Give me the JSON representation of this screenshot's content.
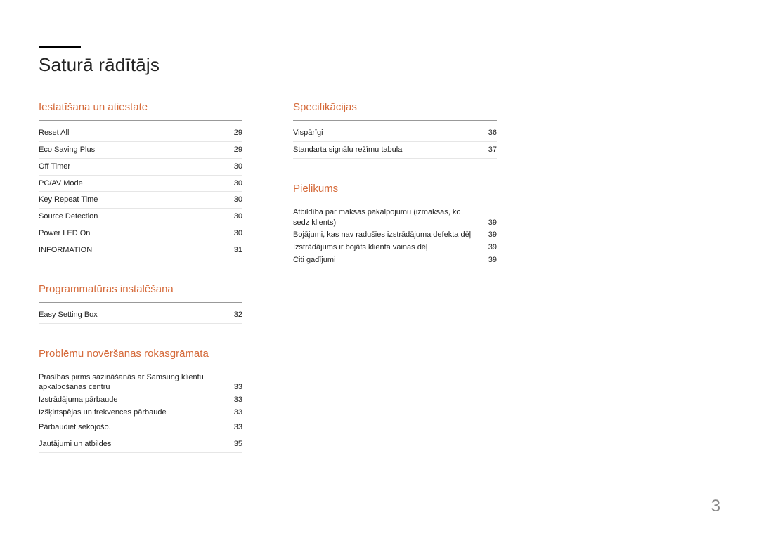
{
  "page_title": "Saturā rādītājs",
  "page_number": "3",
  "left_col": {
    "sections": [
      {
        "title": "Iestatīšana un atiestate",
        "entries": [
          {
            "label": "Reset All",
            "page": "29"
          },
          {
            "label": "Eco Saving Plus",
            "page": "29"
          },
          {
            "label": "Off Timer",
            "page": "30"
          },
          {
            "label": "PC/AV Mode",
            "page": "30"
          },
          {
            "label": "Key Repeat Time",
            "page": "30"
          },
          {
            "label": "Source Detection",
            "page": "30"
          },
          {
            "label": "Power LED On",
            "page": "30"
          },
          {
            "label": "INFORMATION",
            "page": "31"
          }
        ]
      },
      {
        "title": "Programmatūras instalēšana",
        "entries": [
          {
            "label": "Easy Setting Box",
            "page": "32"
          }
        ]
      },
      {
        "title": "Problēmu novēršanas rokasgrāmata",
        "entries": [
          {
            "label": "Prasības pirms sazināšanās ar Samsung klientu apkalpošanas centru",
            "page": "33"
          },
          {
            "label": "Izstrādājuma pārbaude",
            "page": "33",
            "sub": true
          },
          {
            "label": "Izšķirtspējas un frekvences pārbaude",
            "page": "33",
            "sub": true
          },
          {
            "label": "Pārbaudiet sekojošo.",
            "page": "33",
            "sub": true
          },
          {
            "label": "Jautājumi un atbildes",
            "page": "35"
          }
        ]
      }
    ]
  },
  "right_col": {
    "sections": [
      {
        "title": "Specifikācijas",
        "entries": [
          {
            "label": "Vispārīgi",
            "page": "36"
          },
          {
            "label": "Standarta signālu režīmu tabula",
            "page": "37"
          }
        ]
      },
      {
        "title": "Pielikums",
        "entries": [
          {
            "label": "Atbildība par maksas pakalpojumu (izmaksas, ko sedz klients)",
            "page": "39"
          },
          {
            "label": "Bojājumi, kas nav radušies izstrādājuma defekta dēļ",
            "page": "39",
            "sub": true
          },
          {
            "label": "Izstrādājums ir bojāts klienta vainas dēļ",
            "page": "39",
            "sub": true
          },
          {
            "label": "Citi gadījumi",
            "page": "39",
            "sub": true
          }
        ]
      }
    ]
  }
}
